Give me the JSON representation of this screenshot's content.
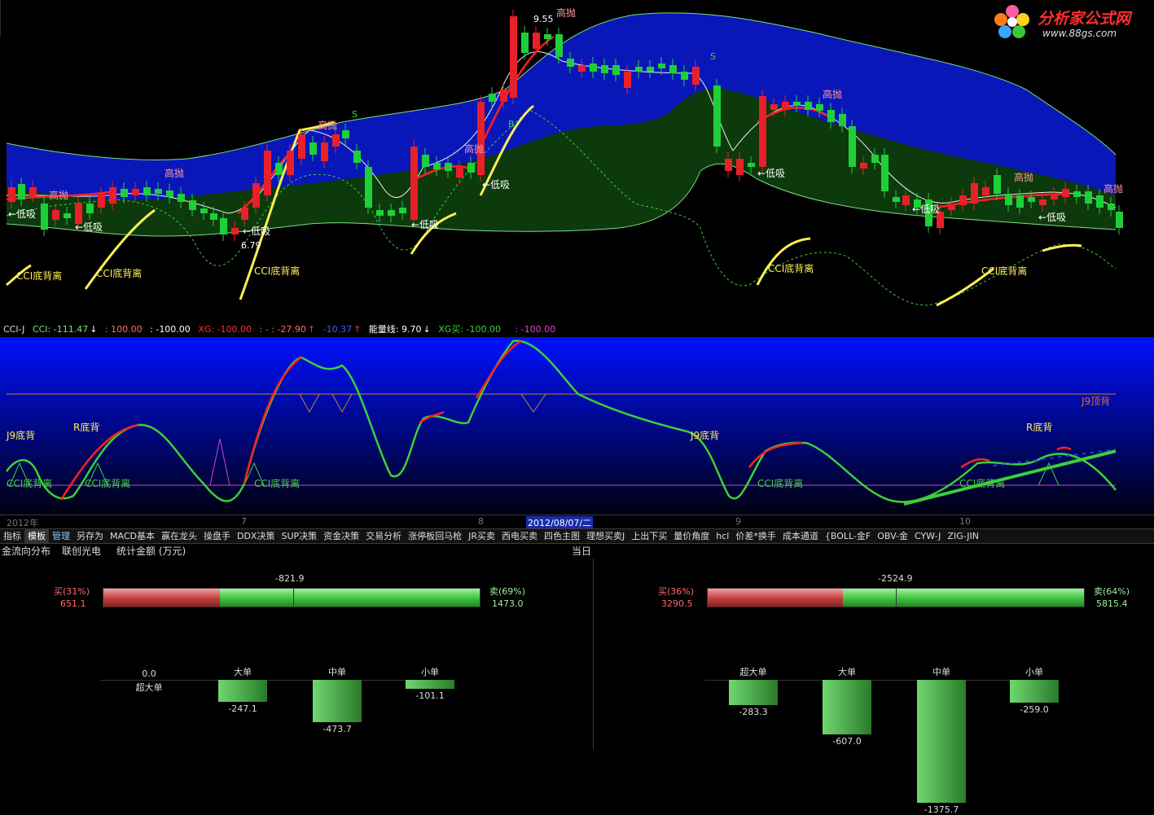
{
  "logo": {
    "name": "分析家公式网",
    "url": "www.88gs.com"
  },
  "main_chart": {
    "labels": {
      "high_sell": "高抛",
      "low_buy": "←低吸",
      "cci_bottom": "CCI底背离",
      "price_high": "9.55",
      "price_low": "6.79",
      "signal_s": "S",
      "signal_b": "B"
    }
  },
  "indicator_bar": {
    "name": "CCI-J",
    "cci": "CCI: -111.47",
    "v1": ": 100.00",
    "v2": ": -100.00",
    "xg": "XG: -100.00",
    "v3": ": - : -27.90",
    "v4": "-10.37",
    "energy": "能量线: 9.70",
    "xg_buy": "XG买: -100.00",
    "v5": ": -100.00"
  },
  "sub_chart": {
    "labels": {
      "j9_bottom": "J9底背",
      "r_bottom": "R底背",
      "cci_bottom": "CCI底背离",
      "j9_top": "J9顶背"
    }
  },
  "time_axis": {
    "year": "2012年",
    "m7": "7",
    "m8": "8",
    "date": "2012/08/07/二",
    "m9": "9",
    "m10": "10"
  },
  "tabs": [
    "指标",
    "模板",
    "管理",
    "另存为",
    "MACD基本",
    "赢在龙头",
    "操盘手",
    "DDX决策",
    "SUP决策",
    "资金决策",
    "交易分析",
    "涨停板回马枪",
    "JR买卖",
    "西电买卖",
    "四色主图",
    "理想买卖J",
    "上出下买",
    "量价角度",
    "hcl",
    "价差*换手",
    "成本通道",
    "{BOLL-金F",
    "OBV-金",
    "CYW-J",
    "ZIG-JIN"
  ],
  "fund_header": {
    "title": "金流向分布",
    "stock": "联创光电",
    "metric": "统计金额 (万元)",
    "period": "当日"
  },
  "left_panel": {
    "buy_label": "买(31%)",
    "buy_value": "651.1",
    "sell_label": "卖(69%)",
    "sell_value": "1473.0",
    "net": "-821.9",
    "buy_pct": 31,
    "categories": [
      {
        "name": "超大单",
        "value": "0.0",
        "v": 0
      },
      {
        "name": "大单",
        "value": "-247.1",
        "v": -247.1
      },
      {
        "name": "中单",
        "value": "-473.7",
        "v": -473.7
      },
      {
        "name": "小单",
        "value": "-101.1",
        "v": -101.1
      }
    ]
  },
  "right_panel": {
    "buy_label": "买(36%)",
    "buy_value": "3290.5",
    "sell_label": "卖(64%)",
    "sell_value": "5815.4",
    "net": "-2524.9",
    "buy_pct": 36,
    "categories": [
      {
        "name": "超大单",
        "value": "-283.3",
        "v": -283.3
      },
      {
        "name": "大单",
        "value": "-607.0",
        "v": -607.0
      },
      {
        "name": "中单",
        "value": "-1375.7",
        "v": -1375.7
      },
      {
        "name": "小单",
        "value": "-259.0",
        "v": -259.0
      }
    ]
  },
  "colors": {
    "up": "#e8202a",
    "down": "#1fcf3a",
    "blue_band": "#0a17b8",
    "green_band": "#0c3a0c",
    "yellow": "#ffee55"
  }
}
